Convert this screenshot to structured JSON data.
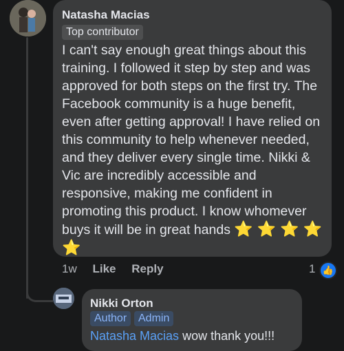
{
  "comment": {
    "author": "Natasha Macias",
    "badge": "Top contributor",
    "text": "I can't say enough great things about this training. I followed it step by step and was approved for both steps on the first try. The Facebook community is a huge benefit, even after getting approval! I have relied on this community to help whenever needed, and they deliver every single time. Nikki & Vic are incredibly accessible and responsive, making me confident in promoting this product. I know whomever buys it will be in great hands",
    "stars": "⭐ ⭐ ⭐ ⭐ ⭐",
    "time": "1w",
    "like_label": "Like",
    "reply_label": "Reply",
    "reaction_count": "1",
    "reaction_icon": "like-icon"
  },
  "reply": {
    "author": "Nikki Orton",
    "badges": [
      "Author",
      "Admin"
    ],
    "mention": "Natasha Macias",
    "text": " wow thank you!!!"
  },
  "colors": {
    "background": "#18191a",
    "bubble": "#3a3b3c",
    "mention": "#5aa0f5",
    "like_blue": "#1877f2",
    "star": "#f7c600"
  }
}
